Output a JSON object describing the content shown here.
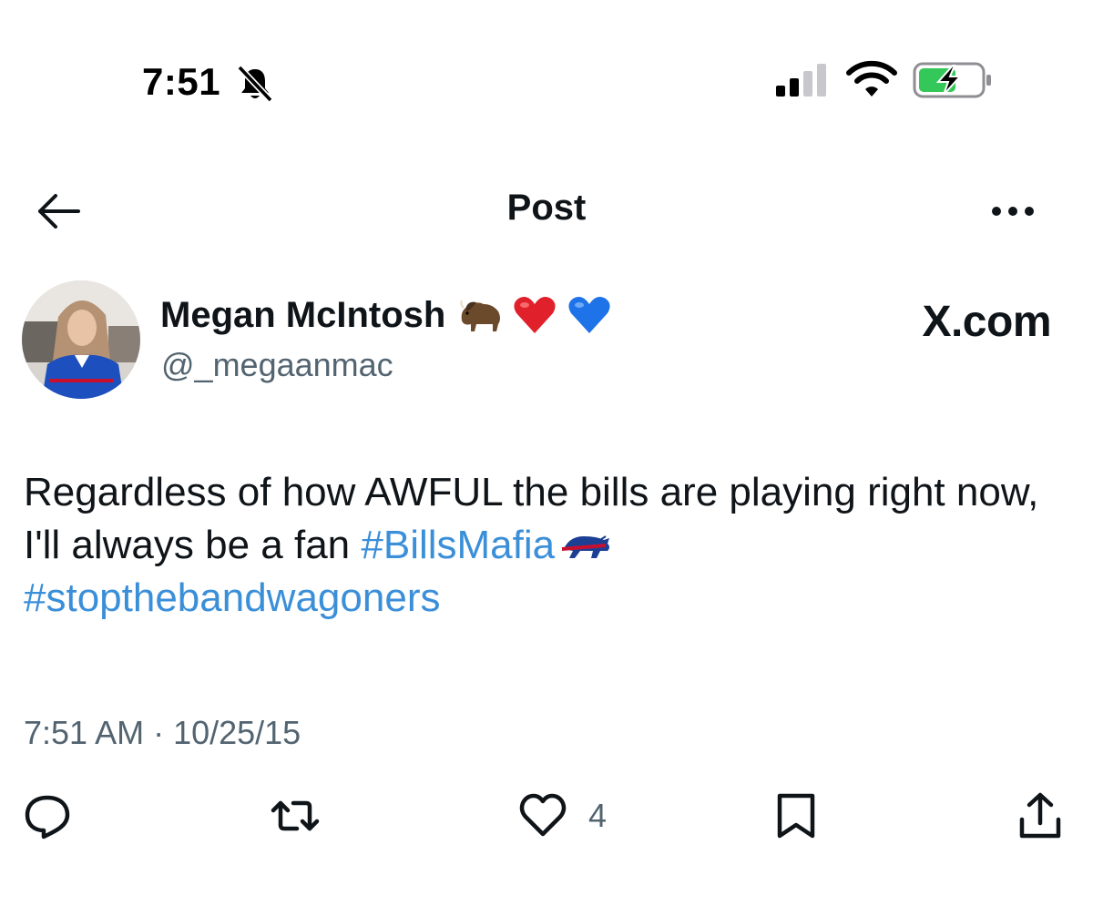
{
  "status_bar": {
    "time": "7:51"
  },
  "header": {
    "title": "Post"
  },
  "author": {
    "name": "Megan McIntosh",
    "handle": "@_megaanmac",
    "name_emojis": [
      "bison-emoji",
      "red-heart-emoji",
      "blue-heart-emoji"
    ]
  },
  "watermark": {
    "text": "X.com"
  },
  "tweet": {
    "text_main": "Regardless of how AWFUL the bills are playing right now, I'll always be a fan ",
    "hashtag_1": "#BillsMafia",
    "hashtag_2": "#stopthebandwagoners",
    "timestamp": "7:51 AM · 10/25/15"
  },
  "actions": {
    "like_count": "4"
  },
  "colors": {
    "hashtag": "#3b8fd9",
    "secondary_text": "#536471",
    "primary_text": "#0f1419",
    "battery_fill": "#34c759"
  }
}
